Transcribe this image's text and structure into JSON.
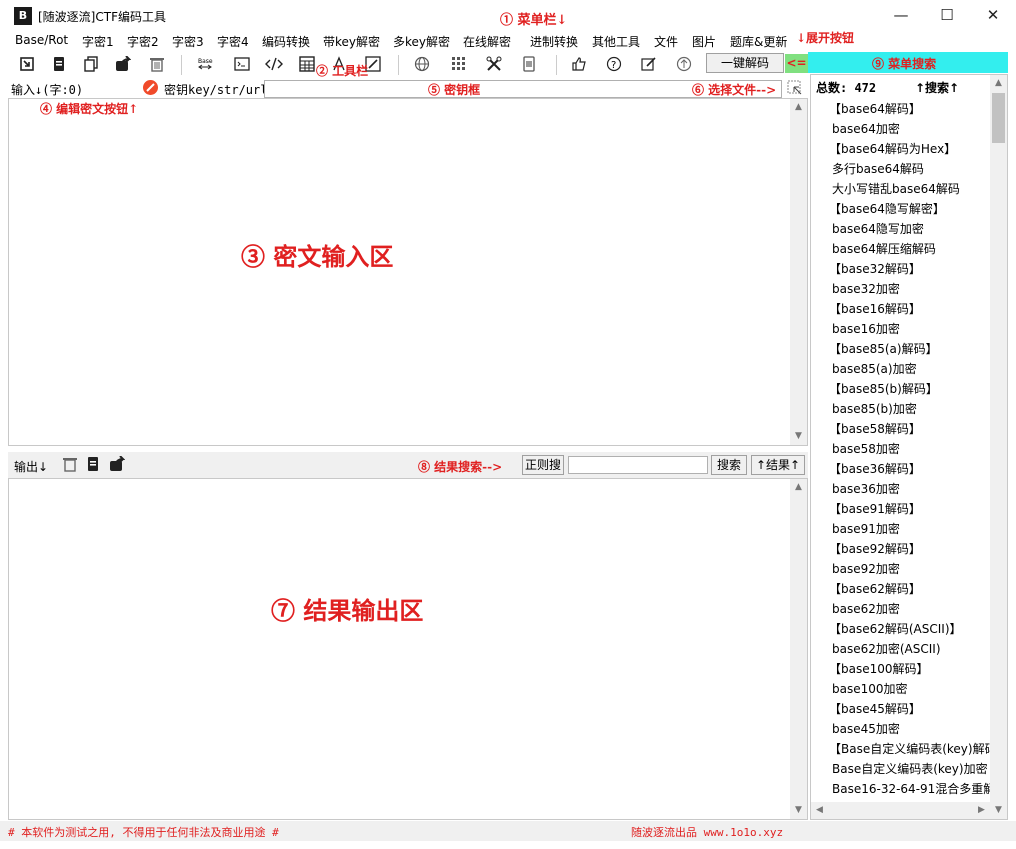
{
  "window": {
    "app_icon_text": "B",
    "title": "[随波逐流]CTF编码工具",
    "minimize": "—",
    "maximize": "☐",
    "close": "✕"
  },
  "menubar": {
    "items": [
      "Base/Rot",
      "字密1",
      "字密2",
      "字密3",
      "字密4",
      "编码转换",
      "带key解密",
      "多key解密",
      "在线解密",
      "进制转换",
      "其他工具",
      "文件",
      "图片",
      "题库&更新"
    ]
  },
  "annotations": {
    "menubar": "① 菜单栏↓",
    "expand": "↓展开按钮",
    "toolbar": "② 工具栏",
    "edit_btn": "④ 编辑密文按钮↑",
    "key_box": "⑤ 密钥框",
    "choose_file": "⑥ 选择文件-->",
    "input_area": "③ 密文输入区",
    "output_area": "⑦ 结果输出区",
    "result_search": "⑧ 结果搜索-->",
    "menu_search": "⑨ 菜单搜索"
  },
  "toolbar": {
    "one_key_decode": "一键解码",
    "expand_arrow": "<="
  },
  "keyrow": {
    "input_label": "输入↓(字:0)",
    "key_label": "密钥key/str/url:",
    "key_value": ""
  },
  "output": {
    "label": "输出↓",
    "regex_label": "正则搜",
    "search_value": "",
    "search_btn": "搜索",
    "result_btn": "↑结果↑"
  },
  "sidebar": {
    "total_label": "总数: 472",
    "search_label": "↑搜索↑",
    "items": [
      "【base64解码】",
      "base64加密",
      "【base64解码为Hex】",
      "多行base64解码",
      "大小写错乱base64解码",
      "【base64隐写解密】",
      "base64隐写加密",
      "base64解压缩解码",
      "【base32解码】",
      "base32加密",
      "【base16解码】",
      "base16加密",
      "【base85(a)解码】",
      "base85(a)加密",
      "【base85(b)解码】",
      "base85(b)加密",
      "【base58解码】",
      "base58加密",
      "【base36解码】",
      "base36加密",
      "【base91解码】",
      "base91加密",
      "【base92解码】",
      "base92加密",
      "【base62解码】",
      "base62加密",
      "【base62解码(ASCII)】",
      "base62加密(ASCII)",
      "【base100解码】",
      "base100加密",
      "【base45解码】",
      "base45加密",
      "【Base自定义编码表(key)解码",
      "Base自定义编码表(key)加密",
      "Base16-32-64-91混合多重解"
    ]
  },
  "status": {
    "left": "# 本软件为测试之用, 不得用于任何非法及商业用途 #",
    "right": "随波逐流出品 www.1o1o.xyz"
  },
  "colors": {
    "annotation": "#e02020",
    "menu_search_bg": "#33eeee",
    "expand_btn_bg": "#80e080"
  }
}
